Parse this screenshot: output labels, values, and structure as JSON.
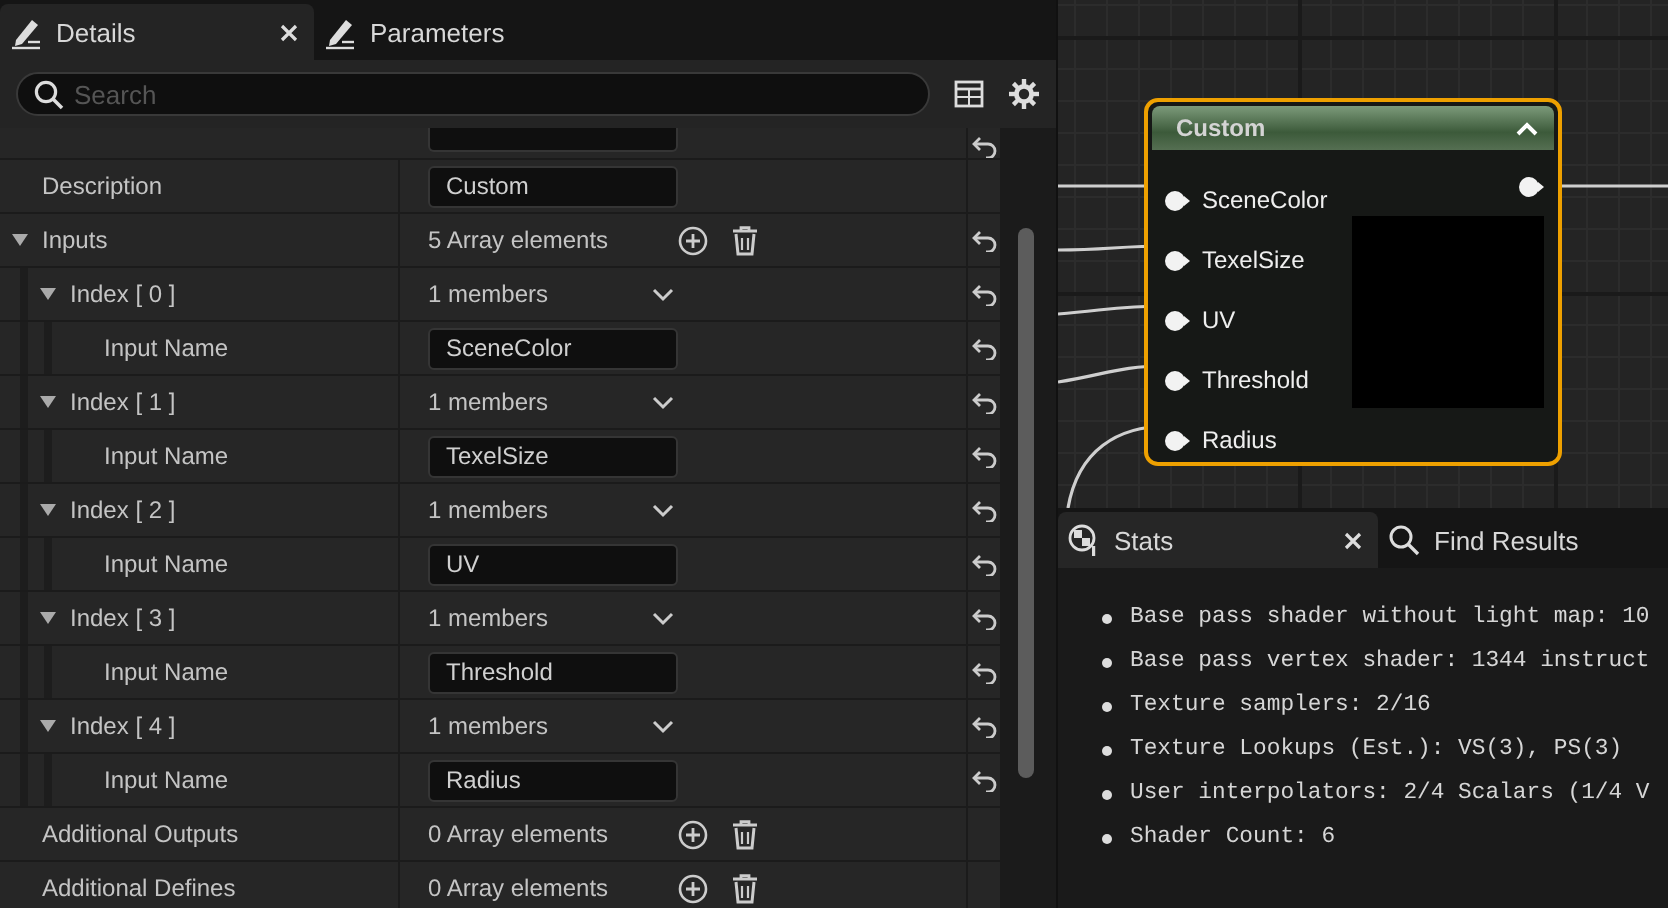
{
  "details_panel": {
    "tabs": [
      {
        "label": "Details",
        "selected": true,
        "closable": true
      },
      {
        "label": "Parameters",
        "selected": false,
        "closable": false
      }
    ],
    "search": {
      "placeholder": "Search"
    },
    "rows": [
      {
        "kind": "partial",
        "resettable": true
      },
      {
        "kind": "property",
        "label": "Description",
        "value": "Custom",
        "resettable": false
      },
      {
        "kind": "array",
        "label": "Inputs",
        "count": "5 Array elements",
        "expanded": true,
        "resettable": true,
        "children": [
          {
            "kind": "index",
            "label": "Index [ 0 ]",
            "value": "1 members",
            "expanded": true,
            "resettable": true,
            "children": [
              {
                "kind": "property",
                "label": "Input Name",
                "value": "SceneColor",
                "resettable": true
              }
            ]
          },
          {
            "kind": "index",
            "label": "Index [ 1 ]",
            "value": "1 members",
            "expanded": true,
            "resettable": true,
            "children": [
              {
                "kind": "property",
                "label": "Input Name",
                "value": "TexelSize",
                "resettable": true
              }
            ]
          },
          {
            "kind": "index",
            "label": "Index [ 2 ]",
            "value": "1 members",
            "expanded": true,
            "resettable": true,
            "children": [
              {
                "kind": "property",
                "label": "Input Name",
                "value": "UV",
                "resettable": true
              }
            ]
          },
          {
            "kind": "index",
            "label": "Index [ 3 ]",
            "value": "1 members",
            "expanded": true,
            "resettable": true,
            "children": [
              {
                "kind": "property",
                "label": "Input Name",
                "value": "Threshold",
                "resettable": true
              }
            ]
          },
          {
            "kind": "index",
            "label": "Index [ 4 ]",
            "value": "1 members",
            "expanded": true,
            "resettable": true,
            "children": [
              {
                "kind": "property",
                "label": "Input Name",
                "value": "Radius",
                "resettable": true
              }
            ]
          }
        ]
      },
      {
        "kind": "array",
        "label": "Additional Outputs",
        "count": "0 Array elements",
        "resettable": false
      },
      {
        "kind": "array",
        "label": "Additional Defines",
        "count": "0 Array elements",
        "resettable": false
      }
    ]
  },
  "graph": {
    "node": {
      "title": "Custom",
      "selected": true,
      "inputs": [
        "SceneColor",
        "TexelSize",
        "UV",
        "Threshold",
        "Radius"
      ]
    }
  },
  "stats_panel": {
    "tabs": [
      {
        "label": "Stats",
        "selected": true,
        "closable": true
      },
      {
        "label": "Find Results",
        "selected": false,
        "closable": false
      }
    ],
    "lines": [
      "Base pass shader without light map: 10",
      "Base pass vertex shader: 1344 instruct",
      "Texture samplers: 2/16",
      "Texture Lookups (Est.): VS(3), PS(3)",
      "User interpolators: 2/4 Scalars (1/4 V",
      "Shader Count: 6"
    ]
  }
}
